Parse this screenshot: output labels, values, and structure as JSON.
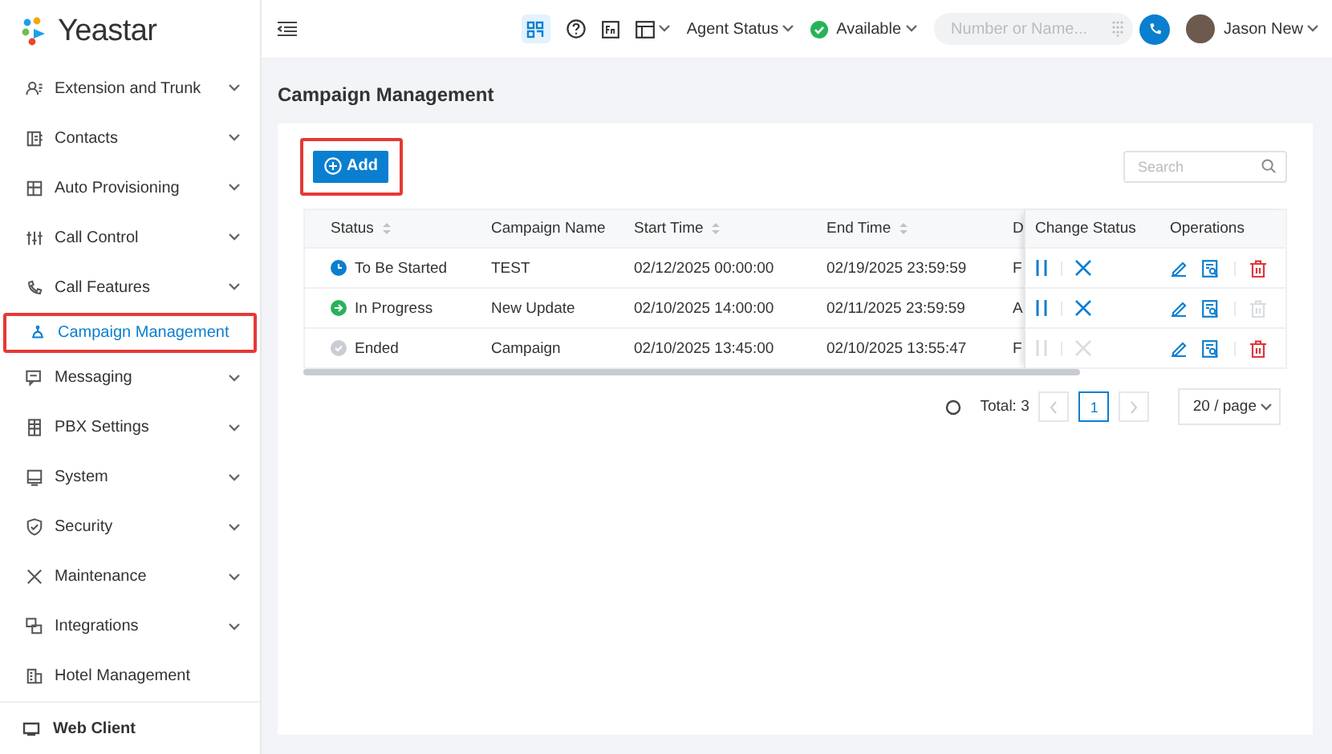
{
  "brand": {
    "name": "Yeastar"
  },
  "sidebar": {
    "items": [
      {
        "label": "Extension and Trunk",
        "expandable": true,
        "selected": false,
        "highlighted": false
      },
      {
        "label": "Contacts",
        "expandable": true,
        "selected": false,
        "highlighted": false
      },
      {
        "label": "Auto Provisioning",
        "expandable": true,
        "selected": false,
        "highlighted": false
      },
      {
        "label": "Call Control",
        "expandable": true,
        "selected": false,
        "highlighted": false
      },
      {
        "label": "Call Features",
        "expandable": true,
        "selected": false,
        "highlighted": false
      },
      {
        "label": "Campaign Management",
        "expandable": false,
        "selected": true,
        "highlighted": true
      },
      {
        "label": "Messaging",
        "expandable": true,
        "selected": false,
        "highlighted": false
      },
      {
        "label": "PBX Settings",
        "expandable": true,
        "selected": false,
        "highlighted": false
      },
      {
        "label": "System",
        "expandable": true,
        "selected": false,
        "highlighted": false
      },
      {
        "label": "Security",
        "expandable": true,
        "selected": false,
        "highlighted": false
      },
      {
        "label": "Maintenance",
        "expandable": true,
        "selected": false,
        "highlighted": false
      },
      {
        "label": "Integrations",
        "expandable": true,
        "selected": false,
        "highlighted": false
      },
      {
        "label": "Hotel Management",
        "expandable": false,
        "selected": false,
        "highlighted": false
      }
    ],
    "footer": "Web Client"
  },
  "topbar": {
    "agent_status": "Agent Status",
    "availability": "Available",
    "dial_field": {
      "placeholder": "Number or Name..."
    },
    "user": "Jason New"
  },
  "page": {
    "title": "Campaign Management",
    "add_button": {
      "label": "Add",
      "highlighted": true
    },
    "search": {
      "placeholder": "Search"
    },
    "table": {
      "columns": [
        "Status",
        "Campaign Name",
        "Start Time",
        "End Time",
        "D",
        "Change Status",
        "Operations"
      ],
      "rows": [
        {
          "status": "To Be Started",
          "kind": "scheduled",
          "color": "#0a7fd0",
          "name": "TEST",
          "start": "02/12/2025 00:00:00",
          "end": "02/19/2025 23:59:59",
          "column_5": "F",
          "pause_disabled": false,
          "stop_disabled": false,
          "delete_disabled": false
        },
        {
          "status": "In Progress",
          "kind": "running",
          "color": "#27b35a",
          "name": "New Update",
          "start": "02/10/2025 14:00:00",
          "end": "02/11/2025 23:59:59",
          "column_5": "A",
          "pause_disabled": false,
          "stop_disabled": false,
          "delete_disabled": true
        },
        {
          "status": "Ended",
          "kind": "ended",
          "color": "#c9cdd4",
          "name": "Campaign",
          "start": "02/10/2025 13:45:00",
          "end": "02/10/2025 13:55:47",
          "column_5": "F",
          "pause_disabled": true,
          "stop_disabled": true,
          "delete_disabled": false
        }
      ]
    },
    "pagination": {
      "total": "Total: 3",
      "pages": [
        {
          "label": "1",
          "selected": true
        }
      ],
      "prev_disabled": true,
      "next_disabled": true,
      "page_size": "20 / page"
    }
  }
}
